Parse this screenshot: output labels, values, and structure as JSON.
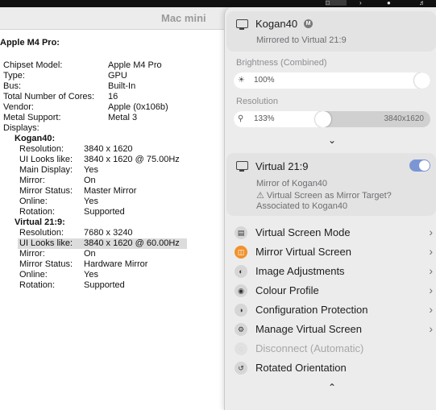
{
  "sysinfo": {
    "window_title": "Mac mini",
    "gpu_heading": "Apple M4 Pro:",
    "rows": [
      {
        "k": "Chipset Model:",
        "v": "Apple M4 Pro"
      },
      {
        "k": "Type:",
        "v": "GPU"
      },
      {
        "k": "Bus:",
        "v": "Built-In"
      },
      {
        "k": "Total Number of Cores:",
        "v": "16"
      },
      {
        "k": "Vendor:",
        "v": "Apple (0x106b)"
      },
      {
        "k": "Metal Support:",
        "v": "Metal 3"
      },
      {
        "k": "Displays:",
        "v": ""
      },
      {
        "k": "Kogan40:",
        "v": ""
      },
      {
        "k": "Resolution:",
        "v": "3840 x 1620"
      },
      {
        "k": "UI Looks like:",
        "v": "3840 x 1620 @ 75.00Hz"
      },
      {
        "k": "Main Display:",
        "v": "Yes"
      },
      {
        "k": "Mirror:",
        "v": "On"
      },
      {
        "k": "Mirror Status:",
        "v": "Master Mirror"
      },
      {
        "k": "Online:",
        "v": "Yes"
      },
      {
        "k": "Rotation:",
        "v": "Supported"
      },
      {
        "k": "Virtual 21:9:",
        "v": ""
      },
      {
        "k": "Resolution:",
        "v": "7680 x 3240"
      },
      {
        "k": "UI Looks like:",
        "v": "3840 x 1620 @ 60.00Hz"
      },
      {
        "k": "Mirror:",
        "v": "On"
      },
      {
        "k": "Mirror Status:",
        "v": "Hardware Mirror"
      },
      {
        "k": "Online:",
        "v": "Yes"
      },
      {
        "k": "Rotation:",
        "v": "Supported"
      }
    ]
  },
  "panel": {
    "display_card": {
      "name": "Kogan40",
      "badge": "M",
      "subtitle": "Mirrored to Virtual 21:9"
    },
    "brightness": {
      "label": "Brightness (Combined)",
      "value_text": "100%",
      "value": 1.0,
      "icon": "sun-icon"
    },
    "resolution": {
      "label": "Resolution",
      "value_text": "133%",
      "value": 0.45,
      "resolution_text": "3840x1620",
      "icon": "magnifier-icon"
    },
    "virtual_card": {
      "name": "Virtual 21:9",
      "enabled": true,
      "line1": "Mirror of Kogan40",
      "line2": "⚠ Virtual Screen as Mirror Target?",
      "line3": "Associated to Kogan40"
    },
    "menu": [
      {
        "label": "Virtual Screen Mode",
        "icon": "layers-icon",
        "submenu": true,
        "disabled": false
      },
      {
        "label": "Mirror Virtual Screen",
        "icon": "mirror-icon",
        "submenu": true,
        "disabled": false
      },
      {
        "label": "Image Adjustments",
        "icon": "adjust-icon",
        "submenu": true,
        "disabled": false
      },
      {
        "label": "Colour Profile",
        "icon": "palette-icon",
        "submenu": true,
        "disabled": false
      },
      {
        "label": "Configuration Protection",
        "icon": "shield-icon",
        "submenu": true,
        "disabled": false
      },
      {
        "label": "Manage Virtual Screen",
        "icon": "gears-icon",
        "submenu": true,
        "disabled": false
      },
      {
        "label": "Disconnect (Automatic)",
        "icon": "power-icon",
        "submenu": false,
        "disabled": true
      },
      {
        "label": "Rotated Orientation",
        "icon": "rotate-icon",
        "submenu": false,
        "disabled": false
      }
    ],
    "colors": {
      "accent_toggle": "#7a96d4",
      "mirror_icon_orange": "#f0922e"
    }
  }
}
